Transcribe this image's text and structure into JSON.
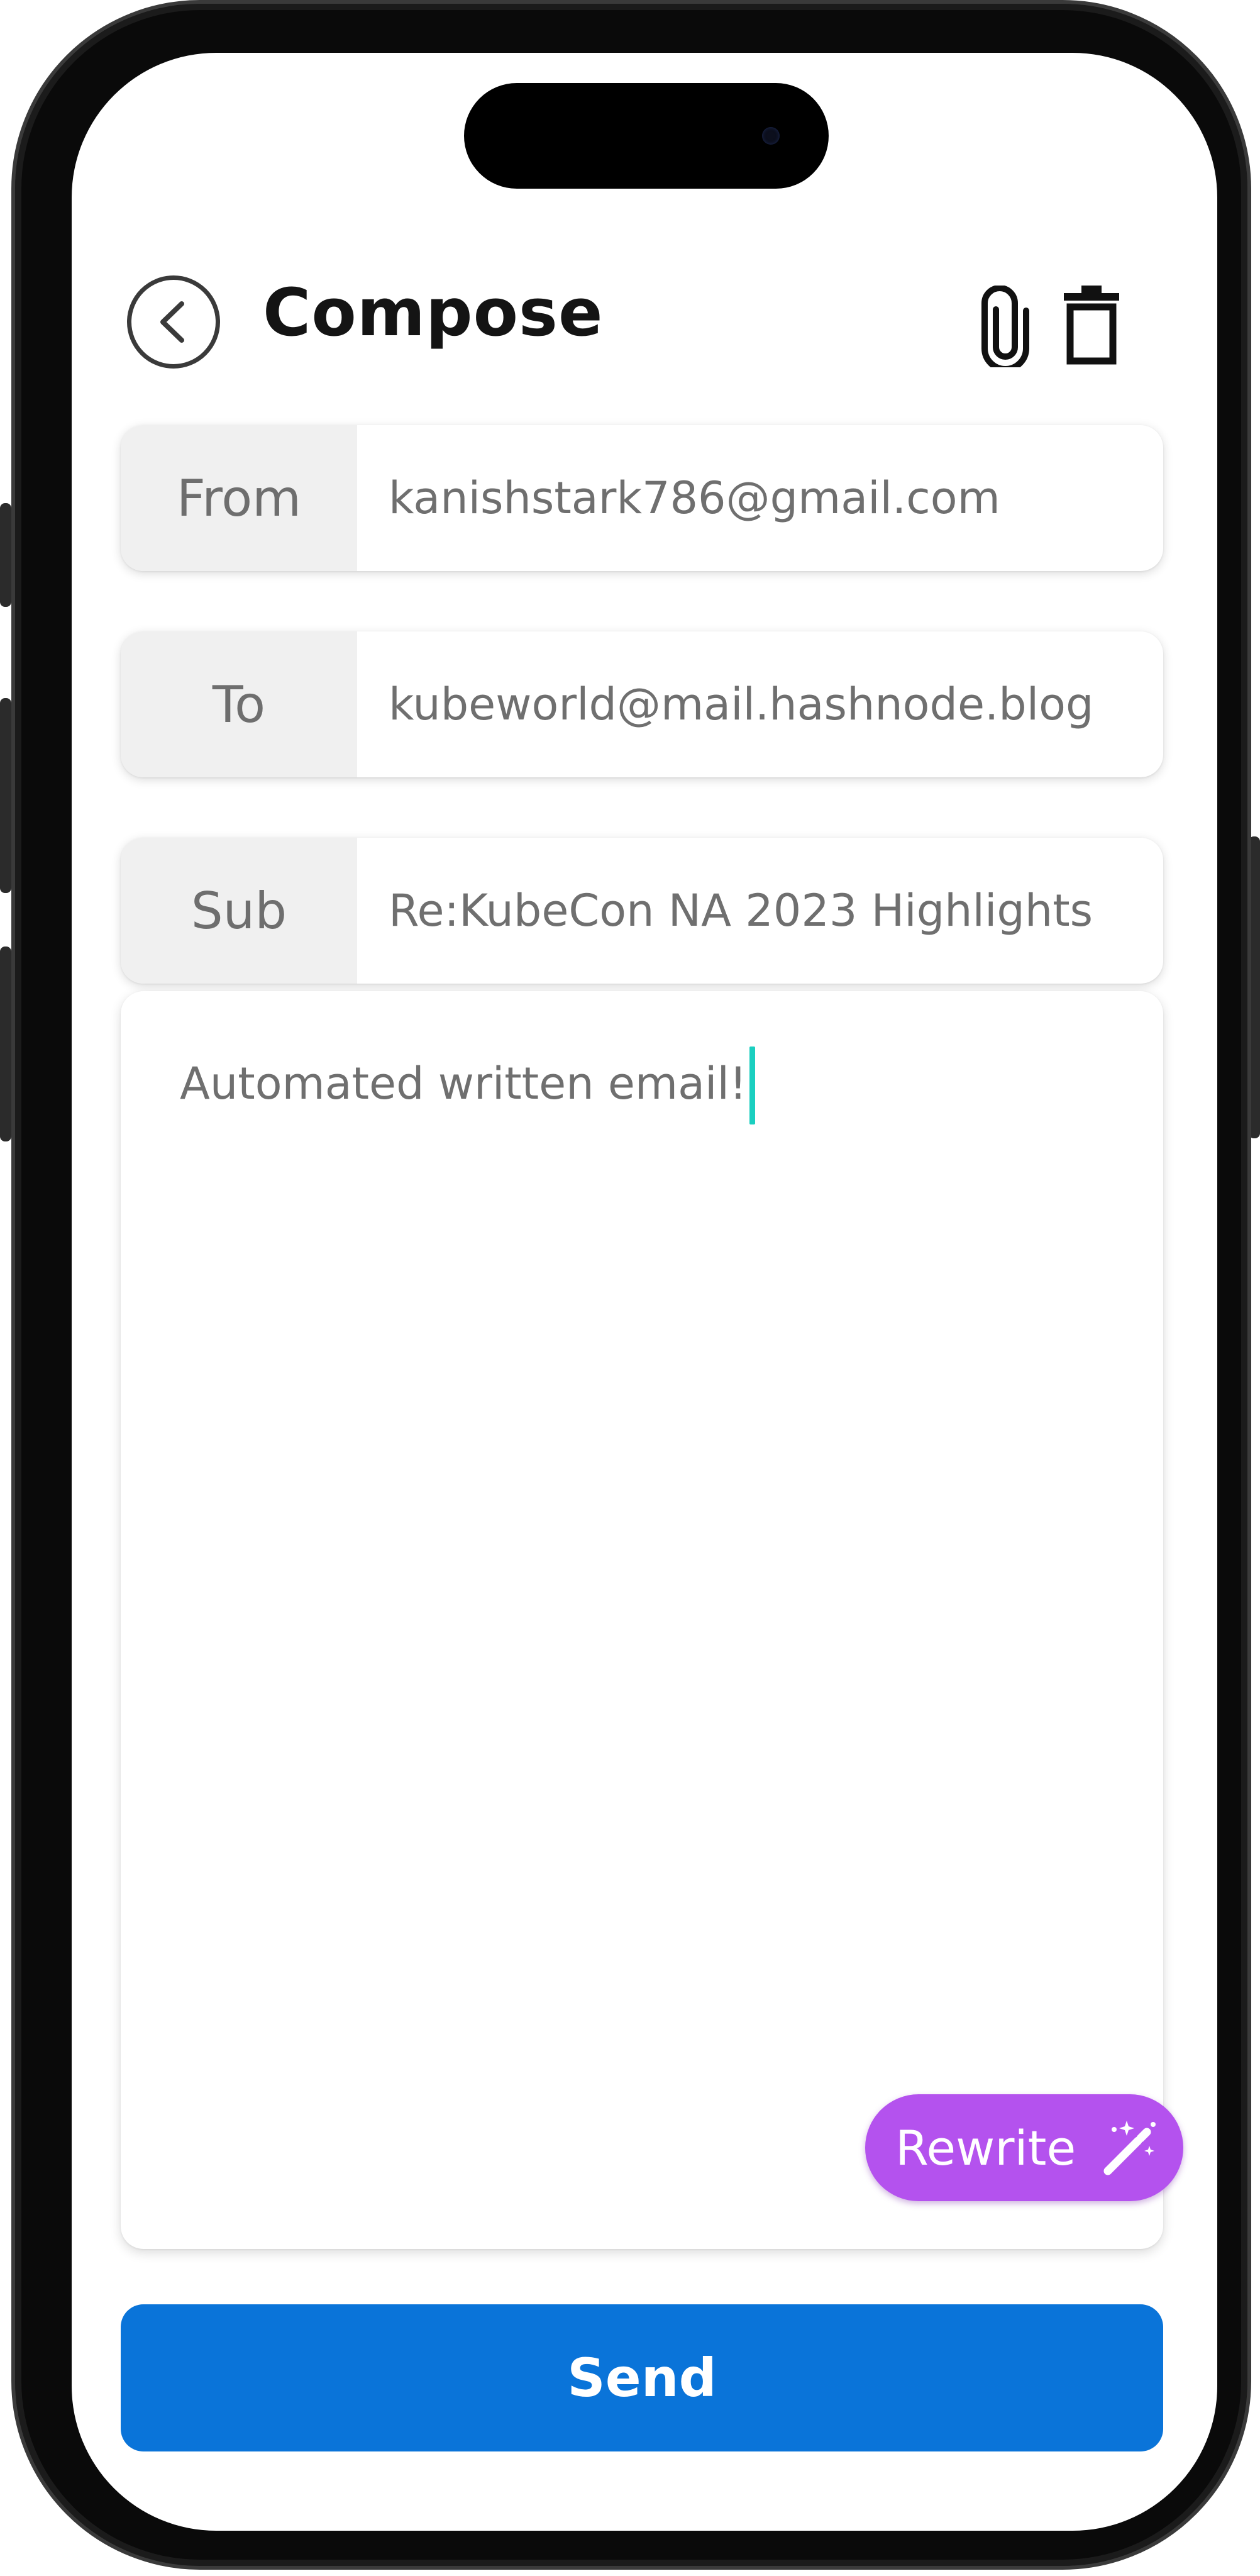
{
  "header": {
    "title": "Compose",
    "back_icon": "chevron-left-circle-icon",
    "attach_icon": "paperclip-icon",
    "delete_icon": "trash-icon"
  },
  "fields": {
    "from": {
      "label": "From",
      "value": "kanishstark786@gmail.com"
    },
    "to": {
      "label": "To",
      "value": "kubeworld@mail.hashnode.blog"
    },
    "subject": {
      "label": "Sub",
      "value": "Re:KubeCon NA 2023 Highlights"
    }
  },
  "body": {
    "text": "Automated written email!"
  },
  "rewrite_button": {
    "label": "Rewrite",
    "icon": "magic-wand-icon",
    "color": "#b452ee"
  },
  "send_button": {
    "label": "Send",
    "color": "#0a74d9"
  },
  "colors": {
    "caret": "#1bcfc0",
    "label_bg": "#f0f0f0",
    "text_gray": "#6f6f6f"
  }
}
